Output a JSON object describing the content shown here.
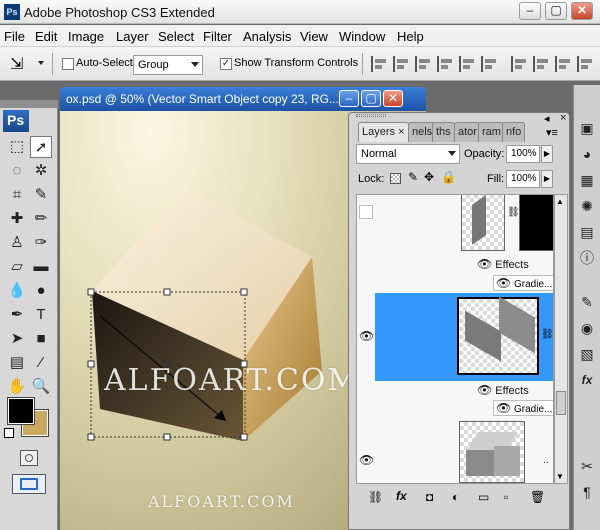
{
  "window": {
    "title": "Adobe Photoshop CS3 Extended",
    "logo": "Ps",
    "buttons": {
      "min": "–",
      "max": "▢",
      "close": "✕"
    }
  },
  "menu": [
    "File",
    "Edit",
    "Image",
    "Layer",
    "Select",
    "Filter",
    "Analysis",
    "View",
    "Window",
    "Help"
  ],
  "options": {
    "auto_select_label": "Auto-Select:",
    "auto_select_value": "Group",
    "transform_label": "Show Transform Controls",
    "transform_checked": "✓"
  },
  "toolbox": {
    "badge": "Ps",
    "tools": [
      "move-tool",
      "marquee-tool",
      "lasso-tool",
      "magic-wand-tool",
      "crop-tool",
      "slice-tool",
      "healing-brush-tool",
      "brush-tool",
      "clone-stamp-tool",
      "history-brush-tool",
      "eraser-tool",
      "gradient-tool",
      "blur-tool",
      "dodge-tool",
      "pen-tool",
      "type-tool",
      "path-selection-tool",
      "shape-tool",
      "notes-tool",
      "eyedropper-tool",
      "hand-tool",
      "zoom-tool"
    ],
    "fg_color": "#000000",
    "bg_color": "#c9a860"
  },
  "document": {
    "title": "ox.psd @ 50% (Vector Smart Object copy 23, RG...",
    "watermark_main": "ALFOART.COM",
    "watermark_small": "ALFOART.COM"
  },
  "layers_panel": {
    "tabs": [
      "Layers",
      "nels",
      "ths",
      "ator",
      "ram",
      "nfo"
    ],
    "tab_close": "×",
    "blend_mode": "Normal",
    "opacity_label": "Opacity:",
    "opacity_value": "100%",
    "lock_label": "Lock:",
    "fill_label": "Fill:",
    "fill_value": "100%",
    "effects_label": "Effects",
    "gradient_label": "Gradie...",
    "effects_label_2": "Effects",
    "gradient_label_2": "Gradie..."
  },
  "colors": {
    "selection": "#3399ff",
    "doc_title": "#1c52a6"
  }
}
